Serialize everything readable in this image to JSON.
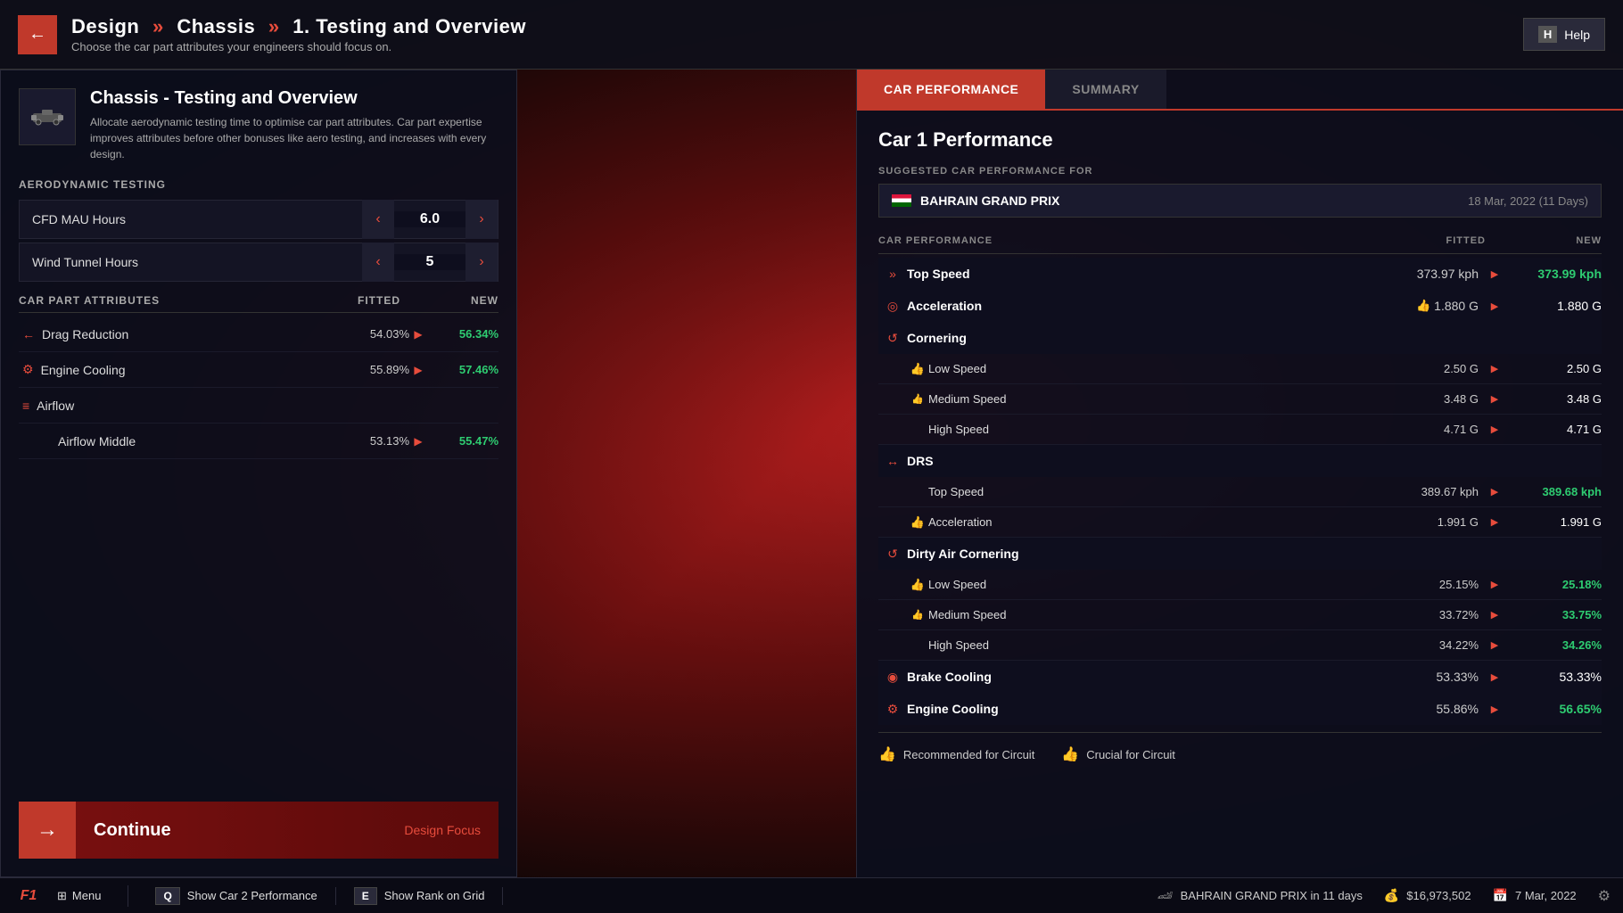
{
  "header": {
    "back_label": "←",
    "breadcrumb_1": "Design",
    "breadcrumb_2": "Chassis",
    "breadcrumb_3": "1. Testing and Overview",
    "subtitle": "Choose the car part attributes your engineers should focus on.",
    "help_key": "H",
    "help_label": "Help"
  },
  "left_panel": {
    "panel_title": "Chassis - Testing and Overview",
    "panel_desc": "Allocate aerodynamic testing time to optimise car part attributes. Car part expertise improves attributes before other bonuses like aero testing, and increases with every design.",
    "aero_section_title": "AERODYNAMIC TESTING",
    "aero_rows": [
      {
        "label": "CFD MAU Hours",
        "value": "6.0"
      },
      {
        "label": "Wind Tunnel Hours",
        "value": "5"
      }
    ],
    "attr_section_title": "CAR PART ATTRIBUTES",
    "col_fitted": "FITTED",
    "col_new": "NEW",
    "attr_rows": [
      {
        "icon": "←",
        "name": "Drag Reduction",
        "fitted": "54.03%",
        "new": "56.34%",
        "indent": false,
        "new_class": "green"
      },
      {
        "icon": "⚙",
        "name": "Engine Cooling",
        "fitted": "55.89%",
        "new": "57.46%",
        "indent": false,
        "new_class": "green"
      },
      {
        "icon": "≡",
        "name": "Airflow",
        "fitted": "",
        "new": "",
        "indent": false,
        "new_class": ""
      },
      {
        "icon": "",
        "name": "Airflow Middle",
        "fitted": "53.13%",
        "new": "55.47%",
        "indent": true,
        "new_class": "green"
      }
    ],
    "continue_label": "Continue",
    "continue_sub": "Design Focus"
  },
  "right_panel": {
    "tab_active": "CAR PERFORMANCE",
    "tab_inactive": "SUMMARY",
    "perf_title": "Car 1 Performance",
    "suggested_label": "SUGGESTED CAR PERFORMANCE FOR",
    "suggested_gp": "BAHRAIN GRAND PRIX",
    "suggested_date": "18 Mar, 2022 (11 Days)",
    "col_fitted": "FITTED",
    "col_new": "NEW",
    "sections": [
      {
        "icon": "»",
        "name": "Top Speed",
        "fitted": "373.97 kph",
        "new": "373.99 kph",
        "new_class": "green",
        "sub": []
      },
      {
        "icon": "◎",
        "name": "Acceleration",
        "fitted": "1.880 G",
        "new": "1.880 G",
        "new_class": "",
        "has_thumb": true,
        "sub": []
      },
      {
        "icon": "↺",
        "name": "Cornering",
        "fitted": "",
        "new": "",
        "new_class": "",
        "sub": [
          {
            "name": "Low Speed",
            "fitted": "2.50 G",
            "new": "2.50 G",
            "new_class": "",
            "has_thumb": true
          },
          {
            "name": "Medium Speed",
            "fitted": "3.48 G",
            "new": "3.48 G",
            "new_class": "",
            "has_thumb2": true
          },
          {
            "name": "High Speed",
            "fitted": "4.71 G",
            "new": "4.71 G",
            "new_class": ""
          }
        ]
      },
      {
        "icon": "↔",
        "name": "DRS",
        "fitted": "",
        "new": "",
        "new_class": "",
        "sub": [
          {
            "name": "Top Speed",
            "fitted": "389.67 kph",
            "new": "389.68 kph",
            "new_class": "green"
          },
          {
            "name": "Acceleration",
            "fitted": "1.991 G",
            "new": "1.991 G",
            "new_class": "",
            "has_thumb": true
          }
        ]
      },
      {
        "icon": "↺",
        "name": "Dirty Air Cornering",
        "fitted": "",
        "new": "",
        "new_class": "",
        "sub": [
          {
            "name": "Low Speed",
            "fitted": "25.15%",
            "new": "25.18%",
            "new_class": "green",
            "has_thumb": true
          },
          {
            "name": "Medium Speed",
            "fitted": "33.72%",
            "new": "33.75%",
            "new_class": "green",
            "has_thumb2": true
          },
          {
            "name": "High Speed",
            "fitted": "34.22%",
            "new": "34.26%",
            "new_class": "green"
          }
        ]
      },
      {
        "icon": "◉",
        "name": "Brake Cooling",
        "fitted": "53.33%",
        "new": "53.33%",
        "new_class": "",
        "sub": []
      },
      {
        "icon": "⚙",
        "name": "Engine Cooling",
        "fitted": "55.86%",
        "new": "56.65%",
        "new_class": "green",
        "sub": []
      }
    ],
    "legend": [
      {
        "icon": "👍",
        "label": "Recommended for Circuit"
      },
      {
        "icon": "👍",
        "label": "Crucial for Circuit"
      }
    ]
  },
  "bottom_bar": {
    "menu_label": "Menu",
    "shortcut1_key": "Q",
    "shortcut1_label": "Show Car 2 Performance",
    "shortcut2_key": "E",
    "shortcut2_label": "Show Rank on Grid",
    "gp_status": "BAHRAIN GRAND PRIX in 11 days",
    "money": "$16,973,502",
    "date": "7 Mar, 2022"
  }
}
